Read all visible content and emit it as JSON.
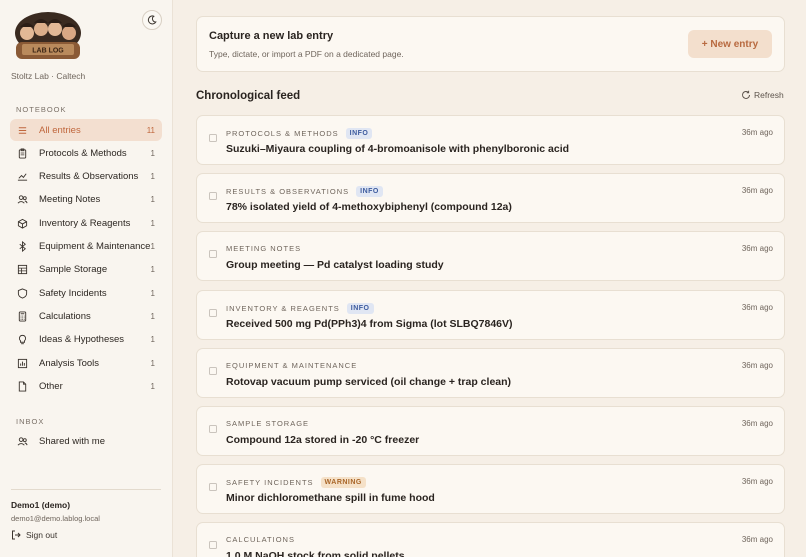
{
  "sidebar": {
    "logo_text": "LAB LOG",
    "lab_name": "Stoltz Lab · Caltech",
    "notebook_label": "NOTEBOOK",
    "items": [
      {
        "label": "All entries",
        "count": "11",
        "icon": "list-icon"
      },
      {
        "label": "Protocols & Methods",
        "count": "1",
        "icon": "clipboard-icon"
      },
      {
        "label": "Results & Observations",
        "count": "1",
        "icon": "trend-icon"
      },
      {
        "label": "Meeting Notes",
        "count": "1",
        "icon": "users-icon"
      },
      {
        "label": "Inventory & Reagents",
        "count": "1",
        "icon": "box-icon"
      },
      {
        "label": "Equipment & Maintenance",
        "count": "1",
        "icon": "bluetooth-icon"
      },
      {
        "label": "Sample Storage",
        "count": "1",
        "icon": "grid-icon"
      },
      {
        "label": "Safety Incidents",
        "count": "1",
        "icon": "shield-icon"
      },
      {
        "label": "Calculations",
        "count": "1",
        "icon": "calculator-icon"
      },
      {
        "label": "Ideas & Hypotheses",
        "count": "1",
        "icon": "lightbulb-icon"
      },
      {
        "label": "Analysis Tools",
        "count": "1",
        "icon": "bar-chart-icon"
      },
      {
        "label": "Other",
        "count": "1",
        "icon": "file-icon"
      }
    ],
    "inbox_label": "INBOX",
    "shared_label": "Shared with me",
    "user_name": "Demo1 (demo)",
    "user_email": "demo1@demo.lablog.local",
    "signout_label": "Sign out"
  },
  "capture": {
    "title": "Capture a new lab entry",
    "subtitle": "Type, dictate, or import a PDF on a dedicated page.",
    "button_label": "+ New entry"
  },
  "feed": {
    "title": "Chronological feed",
    "refresh_label": "Refresh",
    "entries": [
      {
        "category": "PROTOCOLS & METHODS",
        "badge": "INFO",
        "badge_type": "info",
        "time": "36m ago",
        "title": "Suzuki–Miyaura coupling of 4-bromoanisole with phenylboronic acid"
      },
      {
        "category": "RESULTS & OBSERVATIONS",
        "badge": "INFO",
        "badge_type": "info",
        "time": "36m ago",
        "title": "78% isolated yield of 4-methoxybiphenyl (compound 12a)"
      },
      {
        "category": "MEETING NOTES",
        "badge": "",
        "badge_type": "",
        "time": "36m ago",
        "title": "Group meeting — Pd catalyst loading study"
      },
      {
        "category": "INVENTORY & REAGENTS",
        "badge": "INFO",
        "badge_type": "info",
        "time": "36m ago",
        "title": "Received 500 mg Pd(PPh3)4 from Sigma (lot SLBQ7846V)"
      },
      {
        "category": "EQUIPMENT & MAINTENANCE",
        "badge": "",
        "badge_type": "",
        "time": "36m ago",
        "title": "Rotovap vacuum pump serviced (oil change + trap clean)"
      },
      {
        "category": "SAMPLE STORAGE",
        "badge": "",
        "badge_type": "",
        "time": "36m ago",
        "title": "Compound 12a stored in -20 °C freezer"
      },
      {
        "category": "SAFETY INCIDENTS",
        "badge": "WARNING",
        "badge_type": "warning",
        "time": "36m ago",
        "title": "Minor dichloromethane spill in fume hood"
      },
      {
        "category": "CALCULATIONS",
        "badge": "",
        "badge_type": "",
        "time": "36m ago",
        "title": "1.0 M NaOH stock from solid pellets"
      }
    ]
  },
  "colors": {
    "accent": "#c0673d",
    "active_bg": "#f3dfd0",
    "background": "#f6efe6",
    "card": "#fcf8f2"
  }
}
